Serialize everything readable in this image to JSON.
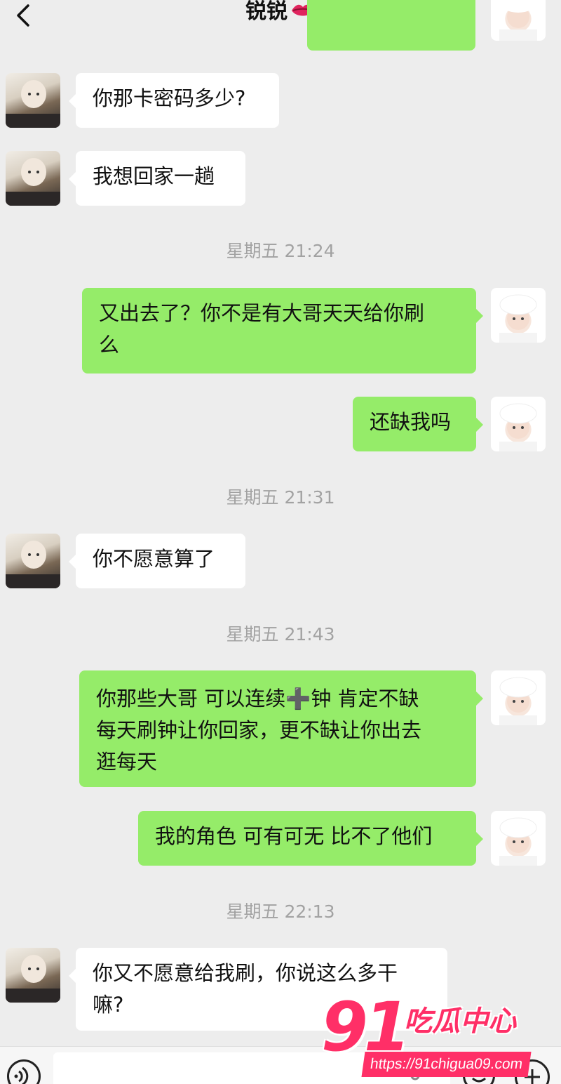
{
  "header": {
    "title": "锐锐",
    "back_icon": "chevron-left-icon",
    "more_icon": "more-dots-icon",
    "title_emoji": "lips-icon"
  },
  "messages": [
    {
      "side": "left",
      "text": "你那卡密码多少?"
    },
    {
      "side": "left",
      "text": "我想回家一趟"
    },
    {
      "type": "time",
      "text": "星期五 21:24"
    },
    {
      "side": "right",
      "lines": [
        "又出去了？你不是有大哥天天给你刷",
        "么"
      ]
    },
    {
      "side": "right",
      "text": "还缺我吗"
    },
    {
      "type": "time",
      "text": "星期五 21:31"
    },
    {
      "side": "left",
      "text": "你不愿意算了"
    },
    {
      "type": "time",
      "text": "星期五 21:43"
    },
    {
      "side": "right",
      "lines": [
        "你那些大哥 可以连续➕钟 肯定不缺",
        "每天刷钟让你回家，更不缺让你出去",
        "逛每天"
      ]
    },
    {
      "side": "right",
      "text": "我的角色 可有可无 比不了他们"
    },
    {
      "type": "time",
      "text": "星期五 22:13"
    },
    {
      "side": "left",
      "lines": [
        "你又不愿意给我刷，你说这么多干",
        "嘛?"
      ]
    }
  ],
  "input_bar": {
    "icons": [
      "voice-icon",
      "microphone-icon",
      "emoji-icon",
      "plus-icon"
    ]
  },
  "watermark": {
    "number": "91",
    "brand": "吃瓜中心",
    "url": "https://91chigua09.com"
  },
  "colors": {
    "background": "#ededed",
    "own_bubble": "#95ec69",
    "other_bubble": "#ffffff",
    "timestamp": "#a2a2a2",
    "watermark": "#ff2f67"
  }
}
